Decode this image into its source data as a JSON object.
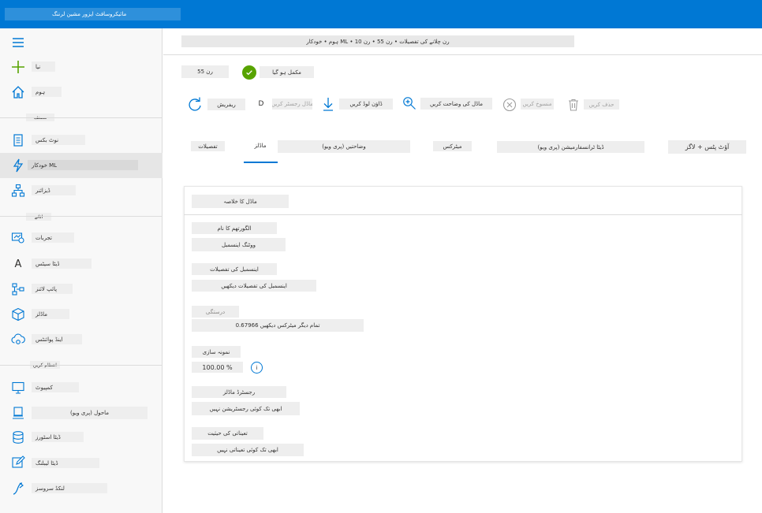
{
  "app": {
    "title": "مائیکروسافٹ ایزور مشین لرننگ"
  },
  "sidebar": {
    "items": [
      {
        "label": "نیا"
      },
      {
        "label": "ہوم"
      },
      {
        "label": "نوٹ بکس"
      },
      {
        "label": "خودکار ML"
      },
      {
        "label": "ڈیزائنر"
      },
      {
        "label": "تجربات"
      },
      {
        "label": "ڈیٹا سیٹس"
      },
      {
        "label": "پائپ لائنز"
      },
      {
        "label": "ماڈلز"
      },
      {
        "label": "اینڈ پوائنٹس"
      },
      {
        "label": "کمپیوٹ"
      },
      {
        "label": "ماحول (پری ویو)"
      },
      {
        "label": "ڈیٹا اسٹورز"
      },
      {
        "label": "ڈیٹا لیبلنگ"
      },
      {
        "label": "لنکڈ سروسز"
      }
    ],
    "sections": {
      "author": "مصنف",
      "assets": "اثاثے",
      "manage": "انتظام کریں"
    }
  },
  "header": {
    "breadcrumb": "ہوم • خودکار ML • رن چلانے کی تفصیلات • رن 55 • رن 10"
  },
  "run": {
    "name": "رن 55",
    "status": "مکمل ہو گیا"
  },
  "toolbar": {
    "refresh": "ریفریش",
    "register": "ماڈل رجسٹر کریں",
    "download": "ڈاؤن لوڈ کریں",
    "explain": "ماڈل کی وضاحت کریں",
    "cancel": "منسوخ کریں",
    "delete": "حذف کریں"
  },
  "tabs": [
    {
      "label": "تفصیلات"
    },
    {
      "label": "ماڈلز"
    },
    {
      "label": "وضاحتیں (پری ویو)"
    },
    {
      "label": "میٹرکس"
    },
    {
      "label": "ڈیٹا ٹرانسفارمیشن (پری ویو)"
    },
    {
      "label": "آؤٹ پٹس + لاگز"
    }
  ],
  "summary": {
    "title": "ماڈل کا خلاصہ",
    "fields": [
      {
        "label": "الگورتھم کا نام",
        "value": "ووٹنگ اینسمبل"
      },
      {
        "label": "اینسمبل کی تفصیلات",
        "value": "اینسمبل کی تفصیلات دیکھیں"
      },
      {
        "label": "درستگی",
        "value": "0.67966 تمام دیگر میٹرکس دیکھیں"
      },
      {
        "label": "نمونہ سازی",
        "value": "100.00 %"
      },
      {
        "label": "رجسٹرڈ ماڈلز",
        "value": "ابھی تک کوئی رجسٹریشن نہیں"
      },
      {
        "label": "تعیناتی کی حیثیت",
        "value": "ابھی تک کوئی تعیناتی نہیں"
      }
    ]
  },
  "colors": {
    "accent": "#0078d4",
    "success": "#57a300"
  }
}
